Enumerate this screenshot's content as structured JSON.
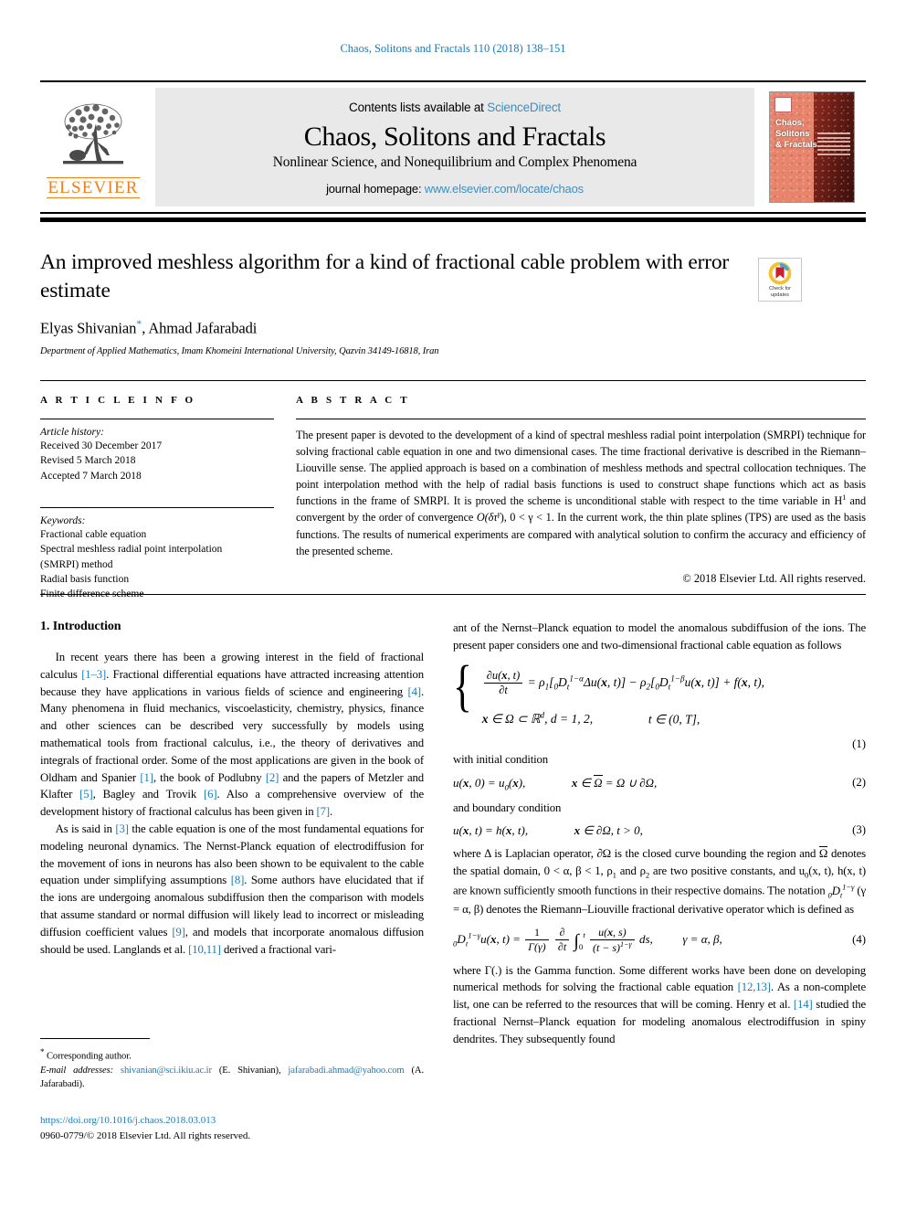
{
  "running_head": "Chaos, Solitons and Fractals 110 (2018) 138–151",
  "masthead": {
    "contents_prefix": "Contents lists available at ",
    "sciencedirect": "ScienceDirect",
    "journal_title": "Chaos, Solitons and Fractals",
    "journal_subtitle": "Nonlinear Science, and Nonequilibrium and Complex Phenomena",
    "homepage_prefix": "journal homepage: ",
    "homepage_url": "www.elsevier.com/locate/chaos",
    "publisher_wordmark": "ELSEVIER",
    "cover_title": "Chaos,\nSolitons\n& Fractals"
  },
  "article": {
    "title": "An improved meshless algorithm for a kind of fractional cable problem with error estimate",
    "authors": "Elyas Shivanian",
    "author_star": "*",
    "authors_rest": ", Ahmad Jafarabadi",
    "affiliation": "Department of Applied Mathematics, Imam Khomeini International University, Qazvin 34149-16818, Iran"
  },
  "crossmark": {
    "line1": "Check for",
    "line2": "updates"
  },
  "info": {
    "heading": "A R T I C L E   I N F O",
    "history_label": "Article history:",
    "received": "Received 30 December 2017",
    "revised": "Revised 5 March 2018",
    "accepted": "Accepted 7 March 2018",
    "keywords_label": "Keywords:",
    "keywords": [
      "Fractional cable equation",
      "Spectral meshless radial point interpolation",
      "(SMRPI) method",
      "Radial basis function",
      "Finite difference scheme"
    ]
  },
  "abstract": {
    "heading": "A B S T R A C T",
    "paragraph_1": "The present paper is devoted to the development of a kind of spectral meshless radial point interpolation (SMRPI) technique for solving fractional cable equation in one and two dimensional cases. The time fractional derivative is described in the Riemann–Liouville sense. The applied approach is based on a combination of meshless methods and spectral collocation techniques. The point interpolation method with the help of radial basis functions is used to construct shape functions which act as basis functions in the frame of SMRPI. It is proved the scheme is unconditional stable with respect to the time variable in H",
    "paragraph_1b": " and convergent by the order of convergence ",
    "order_expr": "O(δτ",
    "order_gamma": "γ",
    "paragraph_1c": "), 0 < γ < 1. In the current work, the thin plate splines (TPS) are used as the basis functions. The results of numerical experiments are compared with analytical solution to confirm the accuracy and efficiency of the presented scheme.",
    "copyright": "© 2018 Elsevier Ltd. All rights reserved."
  },
  "body": {
    "section_1_heading": "1. Introduction",
    "left_p1_a": "In recent years there has been a growing interest in the field of fractional calculus ",
    "left_cite_1_3": "[1–3]",
    "left_p1_b": ". Fractional differential equations have attracted increasing attention because they have applications in various fields of science and engineering ",
    "left_cite_4": "[4]",
    "left_p1_c": ". Many phenomena in fluid mechanics, viscoelasticity, chemistry, physics, finance and other sciences can be described very successfully by models using mathematical tools from fractional calculus, i.e., the theory of derivatives and integrals of fractional order. Some of the most applications are given in the book of Oldham and Spanier ",
    "left_cite_1": "[1]",
    "left_p1_d": ", the book of Podlubny ",
    "left_cite_2": "[2]",
    "left_p1_e": " and the papers of Metzler and Klafter ",
    "left_cite_5": "[5]",
    "left_p1_f": ", Bagley and Trovik ",
    "left_cite_6": "[6]",
    "left_p1_g": ". Also a comprehensive overview of the development history of fractional calculus has been given in ",
    "left_cite_7": "[7]",
    "left_p1_h": ".",
    "left_p2_a": "As is said in ",
    "left_cite_3": "[3]",
    "left_p2_b": " the cable equation is one of the most fundamental equations for modeling neuronal dynamics. The Nernst-Planck equation of electrodiffusion for the movement of ions in neurons has also been shown to be equivalent to the cable equation under simplifying assumptions ",
    "left_cite_8": "[8]",
    "left_p2_c": ". Some authors have elucidated that if the ions are undergoing anomalous subdiffusion then the comparison with models that assume standard or normal diffusion will likely lead to incorrect or misleading diffusion coefficient values ",
    "left_cite_9": "[9]",
    "left_p2_d": ", and models that incorporate anomalous diffusion should be used. Langlands et al. ",
    "left_cite_10_11": "[10,11]",
    "left_p2_e": " derived a fractional vari-",
    "right_p1": "ant of the Nernst–Planck equation to model the anomalous subdiffusion of the ions. The present paper considers one and two-dimensional fractional cable equation as follows",
    "right_p2": "with initial condition",
    "right_p3": "and boundary condition",
    "right_p4_a": "where Δ is Laplacian operator, ∂Ω is the closed curve bounding the region and ",
    "right_p4_b": " denotes the spatial domain, 0 < α, β < 1, ρ",
    "right_p4_c": " and ρ",
    "right_p4_d": " are two positive constants, and u",
    "right_p4_e": "(x, t), h(x, t) are known sufficiently smooth functions in their respective domains. The notation ",
    "right_p4_f": " (γ = α, β) denotes the Riemann–Liouville fractional derivative operator which is defined as",
    "right_p5_a": "where Γ(.) is the Gamma function. Some different works have been done on developing numerical methods for solving the fractional cable equation ",
    "right_cite_12_13": "[12,13]",
    "right_p5_b": ". As a non-complete list, one can be referred to the resources that will be coming. Henry et al. ",
    "right_cite_14": "[14]",
    "right_p5_c": " studied the fractional Nernst–Planck equation for modeling anomalous electrodiffusion in spiny dendrites. They subsequently found"
  },
  "equations": {
    "eq1_num": "(1)",
    "eq1_line1_lhs_num": "∂u(x, t)",
    "eq1_line1_lhs_den": "∂t",
    "eq1_line1_rhs": "= ρ₁[₀D",
    "eq1_line2": "x ∈ Ω ⊂ ℝ",
    "eq1_line2b": ", d = 1, 2,",
    "eq1_line2c": "t ∈ (0, T],",
    "eq2_num": "(2)",
    "eq2_lhs": "u(x, 0) = u₀(x),",
    "eq2_rhs": "x ∈ Ω = Ω ∪ ∂Ω,",
    "eq3_num": "(3)",
    "eq3_lhs": "u(x, t) = h(x, t),",
    "eq3_rhs": "x ∈ ∂Ω, t > 0,",
    "eq4_num": "(4)",
    "eq4_lhs": "₀D",
    "eq4_gamma_cond": "γ = α, β,"
  },
  "footnote": {
    "corresponding": "Corresponding author.",
    "email_label": "E-mail addresses:",
    "email_1": "shivanian@sci.ikiu.ac.ir",
    "email_1_owner": "(E. Shivanian),",
    "email_2": "jafarabadi.ahmad@yahoo.com",
    "email_2_owner": "(A. Jafarabadi).",
    "doi": "https://doi.org/10.1016/j.chaos.2018.03.013",
    "issn_line": "0960-0779/© 2018 Elsevier Ltd. All rights reserved."
  },
  "colors": {
    "link_blue": "#1a7bb9",
    "elsevier_orange": "#f07f1a",
    "masthead_gray": "#e9e9e9"
  }
}
